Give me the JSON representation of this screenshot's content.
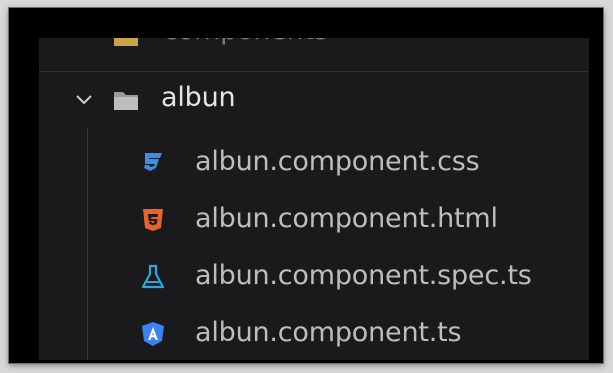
{
  "explorer": {
    "components_label": "components",
    "folder": {
      "label": "albun",
      "expanded": true
    },
    "files": [
      {
        "label": "albun.component.css",
        "icon": "css-icon",
        "color": "#3b8eea"
      },
      {
        "label": "albun.component.html",
        "icon": "html-icon",
        "color": "#e8622a"
      },
      {
        "label": "albun.component.spec.ts",
        "icon": "test-flask-icon",
        "color": "#29a8e0"
      },
      {
        "label": "albun.component.ts",
        "icon": "angular-icon",
        "color": "#3d7ff5"
      }
    ]
  }
}
